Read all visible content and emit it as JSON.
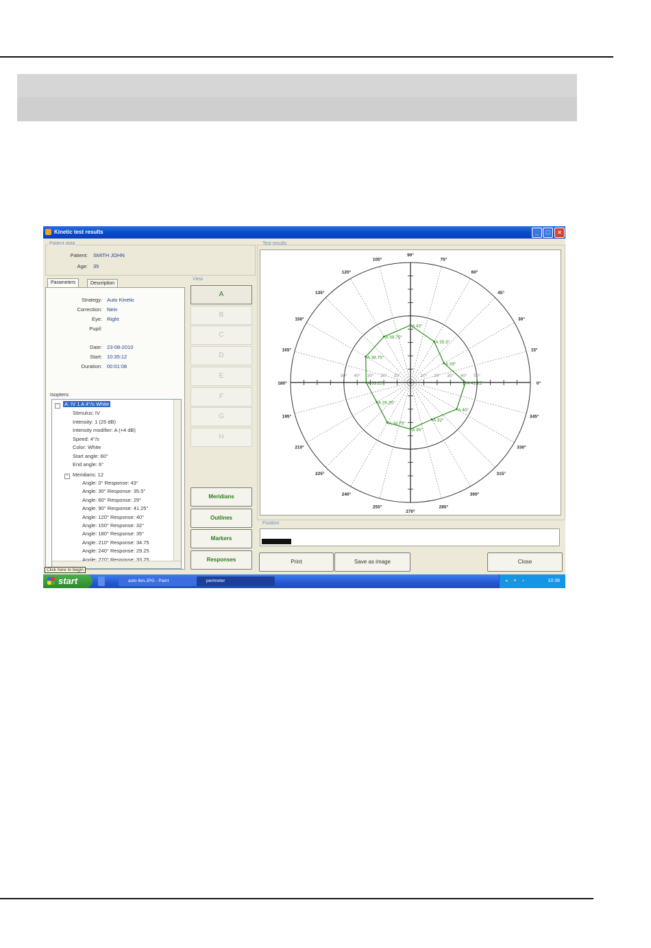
{
  "window": {
    "title": "Kinetic test results"
  },
  "patient": {
    "group_label": "Patient data",
    "patient_label": "Patient:",
    "patient_value": "SMITH JOHN",
    "age_label": "Age:",
    "age_value": "35"
  },
  "tabs": [
    "Parameters",
    "Description"
  ],
  "parameters": [
    {
      "label": "Strategy:",
      "value": "Auto Kinetic"
    },
    {
      "label": "Correction:",
      "value": "Nein"
    },
    {
      "label": "Eye:",
      "value": "Right"
    },
    {
      "label": "Pupil:",
      "value": ""
    },
    {
      "label": "Date:",
      "value": "23-08-2010"
    },
    {
      "label": "Start:",
      "value": "10:35:12"
    },
    {
      "label": "Duration:",
      "value": "00:01:08"
    }
  ],
  "isopters": {
    "label": "Isopters:",
    "selected": "A: IV 1 A  4°/s White",
    "props": [
      "Stimulus: IV",
      "Intensity: 1 (25 dB)",
      "Intensity modifier: A (+4 dB)",
      "Speed: 4°/s",
      "Color: White",
      "Start angle: 60°",
      "End angle: 6°"
    ],
    "meridians_label": "Meridians: 12",
    "meridians": [
      "Angle: 0°  Response: 43°",
      "Angle: 30°  Response: 35.5°",
      "Angle: 60°  Response: 29°",
      "Angle: 90°  Response: 41.25°",
      "Angle: 120°  Response: 40°",
      "Angle: 150°  Response: 32°",
      "Angle: 180°  Response: 35°",
      "Angle: 210°  Response: 34.75",
      "Angle: 240°  Response: 29.25",
      "Angle: 270°  Response: 33.25"
    ],
    "tooltip": "Click here to begin"
  },
  "view": {
    "label": "View",
    "buttons": [
      "A",
      "B",
      "C",
      "D",
      "E",
      "F",
      "G",
      "H"
    ],
    "active": "A"
  },
  "actions": [
    "Meridians",
    "Outlines",
    "Markers",
    "Responses"
  ],
  "results_label": "Test results",
  "fixation_label": "Fixation",
  "fixation_level": 0.1,
  "bottom_buttons": {
    "print": "Print",
    "save": "Save as image",
    "close": "Close"
  },
  "taskbar": {
    "start": "start",
    "tasks": [
      "auto lkin.JPG - Paint",
      "perimeter"
    ],
    "clock": "10:38"
  },
  "colors": {
    "isopter": "#2a8a1a",
    "title_bar": "#0a4bd0",
    "taskbar": "#2457d2",
    "start": "#2c8a2c"
  },
  "chart_data": {
    "type": "polar",
    "angle_labels": [
      "0°",
      "15°",
      "30°",
      "45°",
      "60°",
      "75°",
      "90°",
      "105°",
      "120°",
      "135°",
      "150°",
      "165°",
      "180°",
      "195°",
      "210°",
      "225°",
      "240°",
      "255°",
      "270°",
      "285°",
      "300°",
      "315°",
      "330°",
      "345°"
    ],
    "radial_ticks": [
      "10°",
      "20°",
      "30°",
      "40°",
      "50°"
    ],
    "radial_max": 90,
    "ring_radii": [
      50,
      90
    ],
    "series": [
      {
        "points": [
          {
            "angle": 0,
            "r": 41.25,
            "label": "A 41.25°"
          },
          {
            "angle": 30,
            "r": 29,
            "label": "A 29°"
          },
          {
            "angle": 60,
            "r": 35.5,
            "label": "A 35.5°"
          },
          {
            "angle": 90,
            "r": 43,
            "label": "A 43°"
          },
          {
            "angle": 120,
            "r": 39.75,
            "label": "A 39.75°"
          },
          {
            "angle": 150,
            "r": 38.75,
            "label": "A 38.75°"
          },
          {
            "angle": 180,
            "r": 33.25,
            "label": "A 33.25°"
          },
          {
            "angle": 210,
            "r": 29.25,
            "label": "A 29.25°"
          },
          {
            "angle": 240,
            "r": 34.75,
            "label": "A 34.75°"
          },
          {
            "angle": 270,
            "r": 35,
            "label": "A 35°"
          },
          {
            "angle": 300,
            "r": 32,
            "label": "A 32°"
          },
          {
            "angle": 330,
            "r": 40,
            "label": "A 40°"
          }
        ]
      }
    ]
  }
}
